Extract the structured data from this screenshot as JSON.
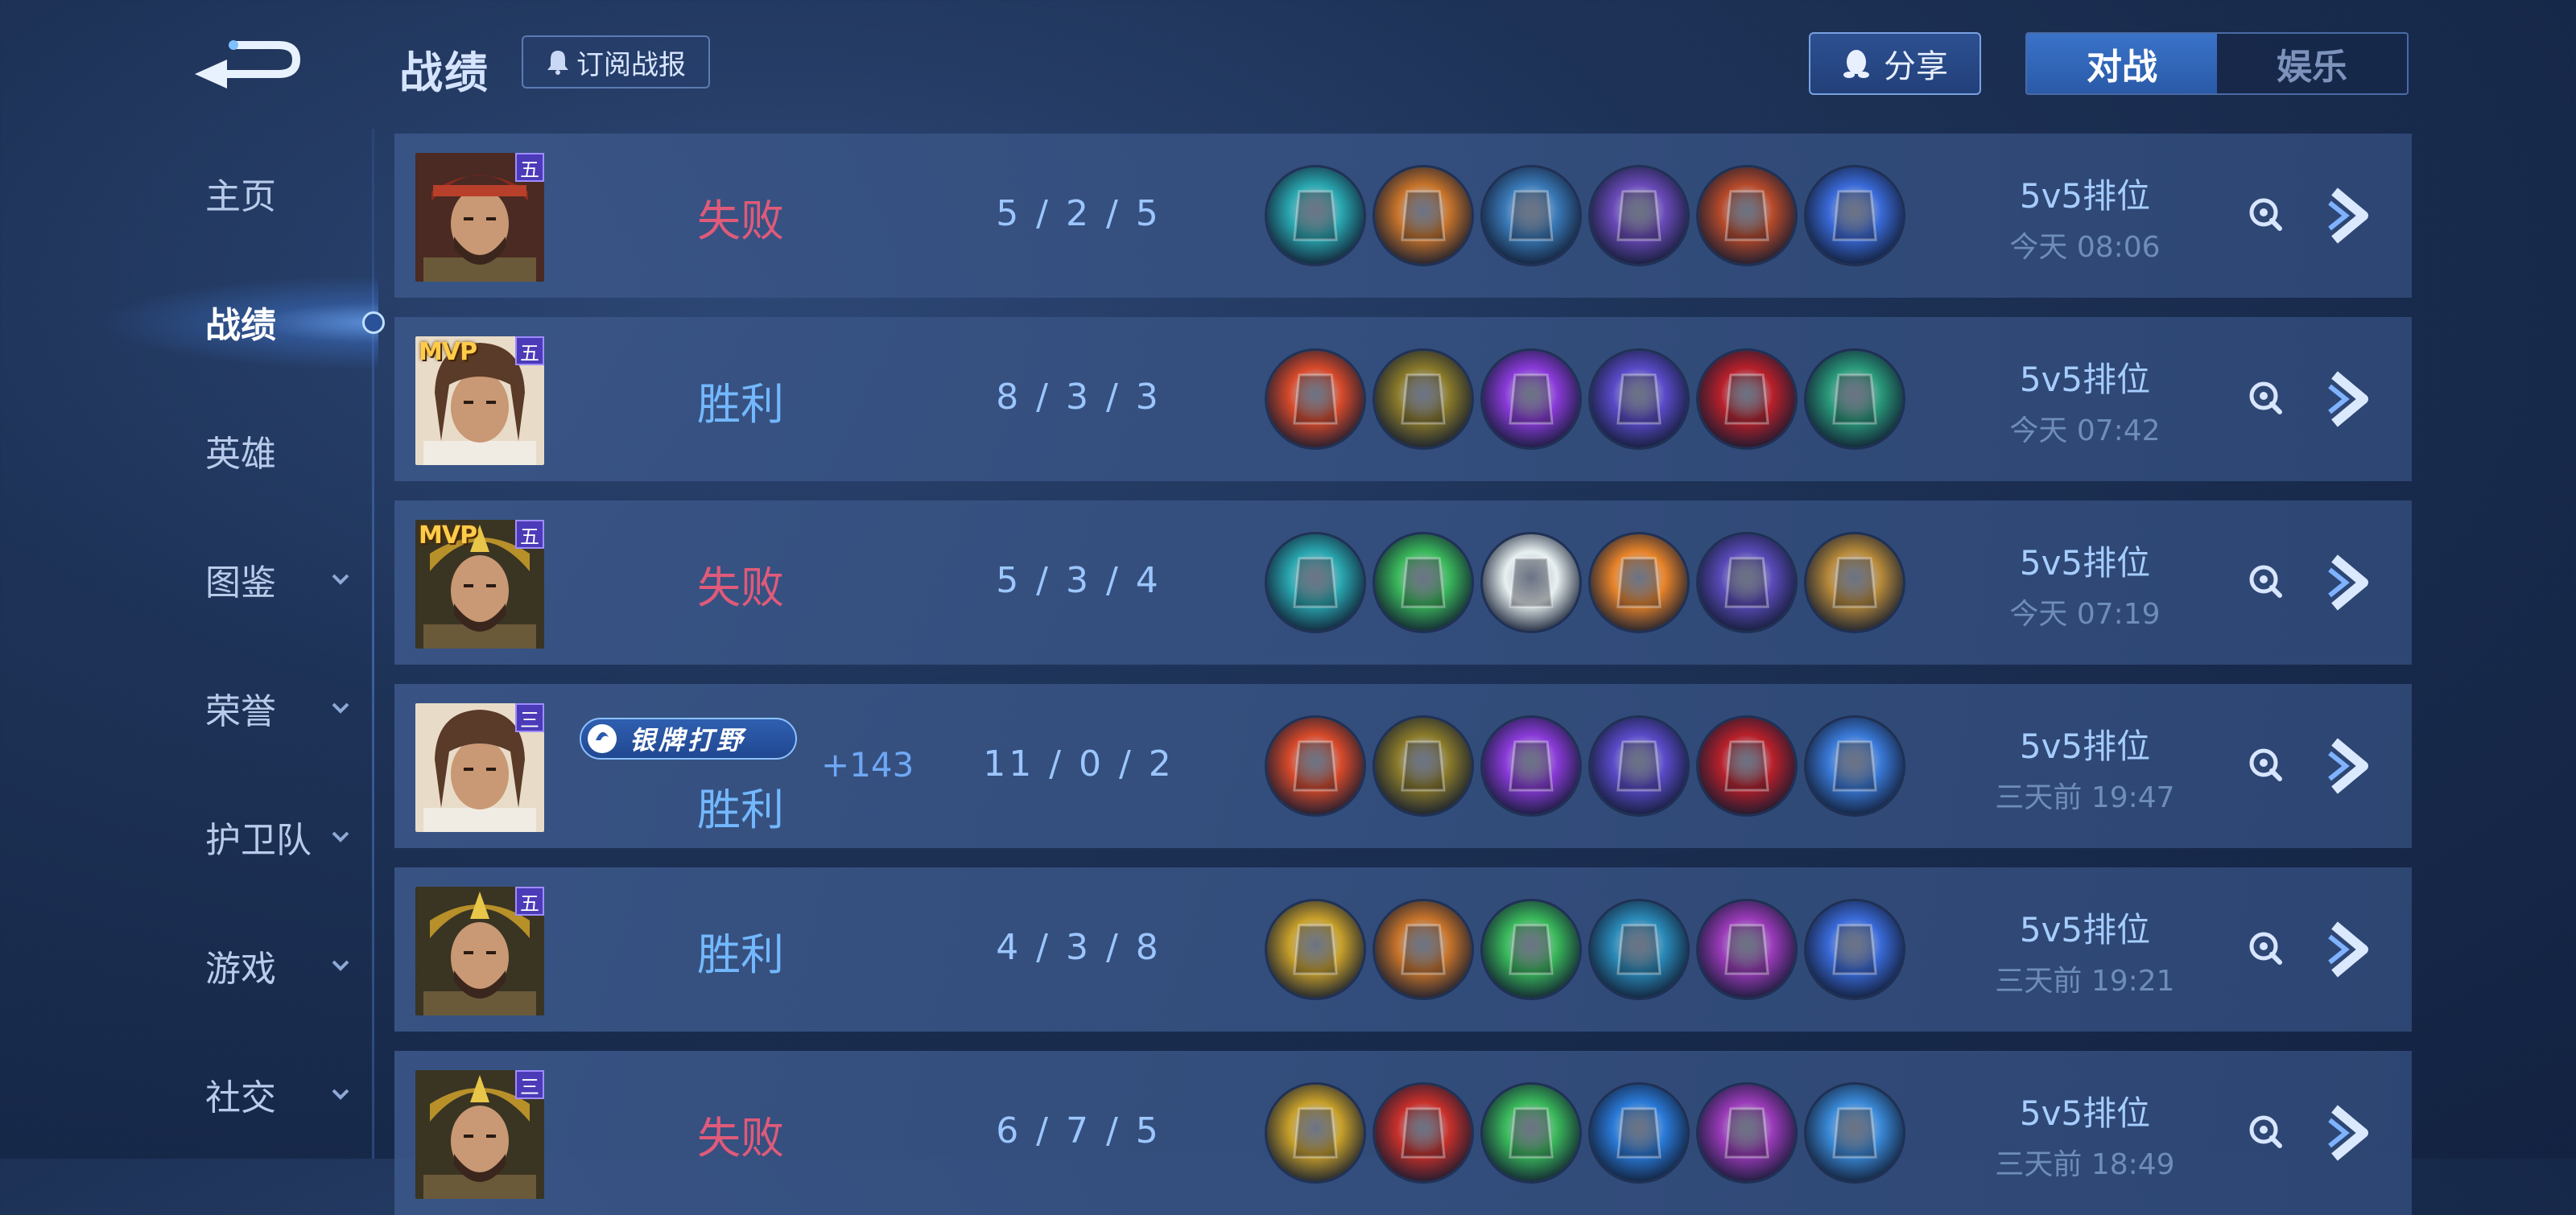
{
  "header": {
    "title": "战绩",
    "subscribe_label": "订阅战报",
    "share_label": "分享",
    "tabs": [
      {
        "label": "对战",
        "active": true
      },
      {
        "label": "娱乐",
        "active": false
      }
    ]
  },
  "sidebar": {
    "items": [
      {
        "label": "主页",
        "active": false,
        "expandable": false
      },
      {
        "label": "战绩",
        "active": true,
        "expandable": false
      },
      {
        "label": "英雄",
        "active": false,
        "expandable": false
      },
      {
        "label": "图鉴",
        "active": false,
        "expandable": true
      },
      {
        "label": "荣誉",
        "active": false,
        "expandable": true
      },
      {
        "label": "护卫队",
        "active": false,
        "expandable": true
      },
      {
        "label": "游戏",
        "active": false,
        "expandable": true
      },
      {
        "label": "社交",
        "active": false,
        "expandable": true
      }
    ]
  },
  "matches": [
    {
      "result": "失败",
      "outcome": "lose",
      "kda": "5 / 2 / 5",
      "mode": "5v5排位",
      "time": "今天 08:06",
      "rank_tag": "五",
      "mvp": "",
      "hero": "red-helmet-warrior",
      "items": [
        "#2aa8b0",
        "#c8742a",
        "#3a7ab8",
        "#6a4ab8",
        "#b84a2a",
        "#3a6ad8"
      ]
    },
    {
      "result": "胜利",
      "outcome": "win",
      "kda": "8 / 3 / 3",
      "mode": "5v5排位",
      "time": "今天 07:42",
      "rank_tag": "五",
      "mvp": "MVP",
      "hero": "long-hair-swordsman",
      "items": [
        "#d84a2a",
        "#8a7a2a",
        "#8a3ad8",
        "#5a4ac8",
        "#b8202a",
        "#2a9a7a"
      ]
    },
    {
      "result": "失败",
      "outcome": "lose",
      "kda": "5 / 3 / 4",
      "mode": "5v5排位",
      "time": "今天 07:19",
      "rank_tag": "五",
      "mvp": "MVP",
      "hero": "golden-armored-general",
      "items": [
        "#2aa8b0",
        "#3ab85a",
        "#e8f0f0",
        "#e8842a",
        "#5a4ab8",
        "#b88a3a"
      ]
    },
    {
      "result": "胜利",
      "outcome": "win",
      "kda": "11 / 0 / 2",
      "mode": "5v5排位",
      "time": "三天前 19:47",
      "rank_tag": "三",
      "mvp": "",
      "title_badge": "银牌打野",
      "points": "+143",
      "hero": "long-hair-swordsman",
      "items": [
        "#d84a2a",
        "#8a7a2a",
        "#8a3ad8",
        "#5a4ac8",
        "#b8202a",
        "#3a7ad8"
      ]
    },
    {
      "result": "胜利",
      "outcome": "win",
      "kda": "4 / 3 / 8",
      "mode": "5v5排位",
      "time": "三天前 19:21",
      "rank_tag": "五",
      "mvp": "",
      "hero": "golden-armored-general",
      "items": [
        "#c8a02a",
        "#c8742a",
        "#3ab85a",
        "#2a8ab8",
        "#9a3ab8",
        "#3a6ad8"
      ]
    },
    {
      "result": "失败",
      "outcome": "lose",
      "kda": "6 / 7 / 5",
      "mode": "5v5排位",
      "time": "三天前 18:49",
      "rank_tag": "三",
      "mvp": "",
      "hero": "golden-armored-general",
      "items": [
        "#c8a02a",
        "#c8302a",
        "#3ab85a",
        "#2a7ad8",
        "#9a3ab8",
        "#3a8ad8"
      ]
    }
  ]
}
